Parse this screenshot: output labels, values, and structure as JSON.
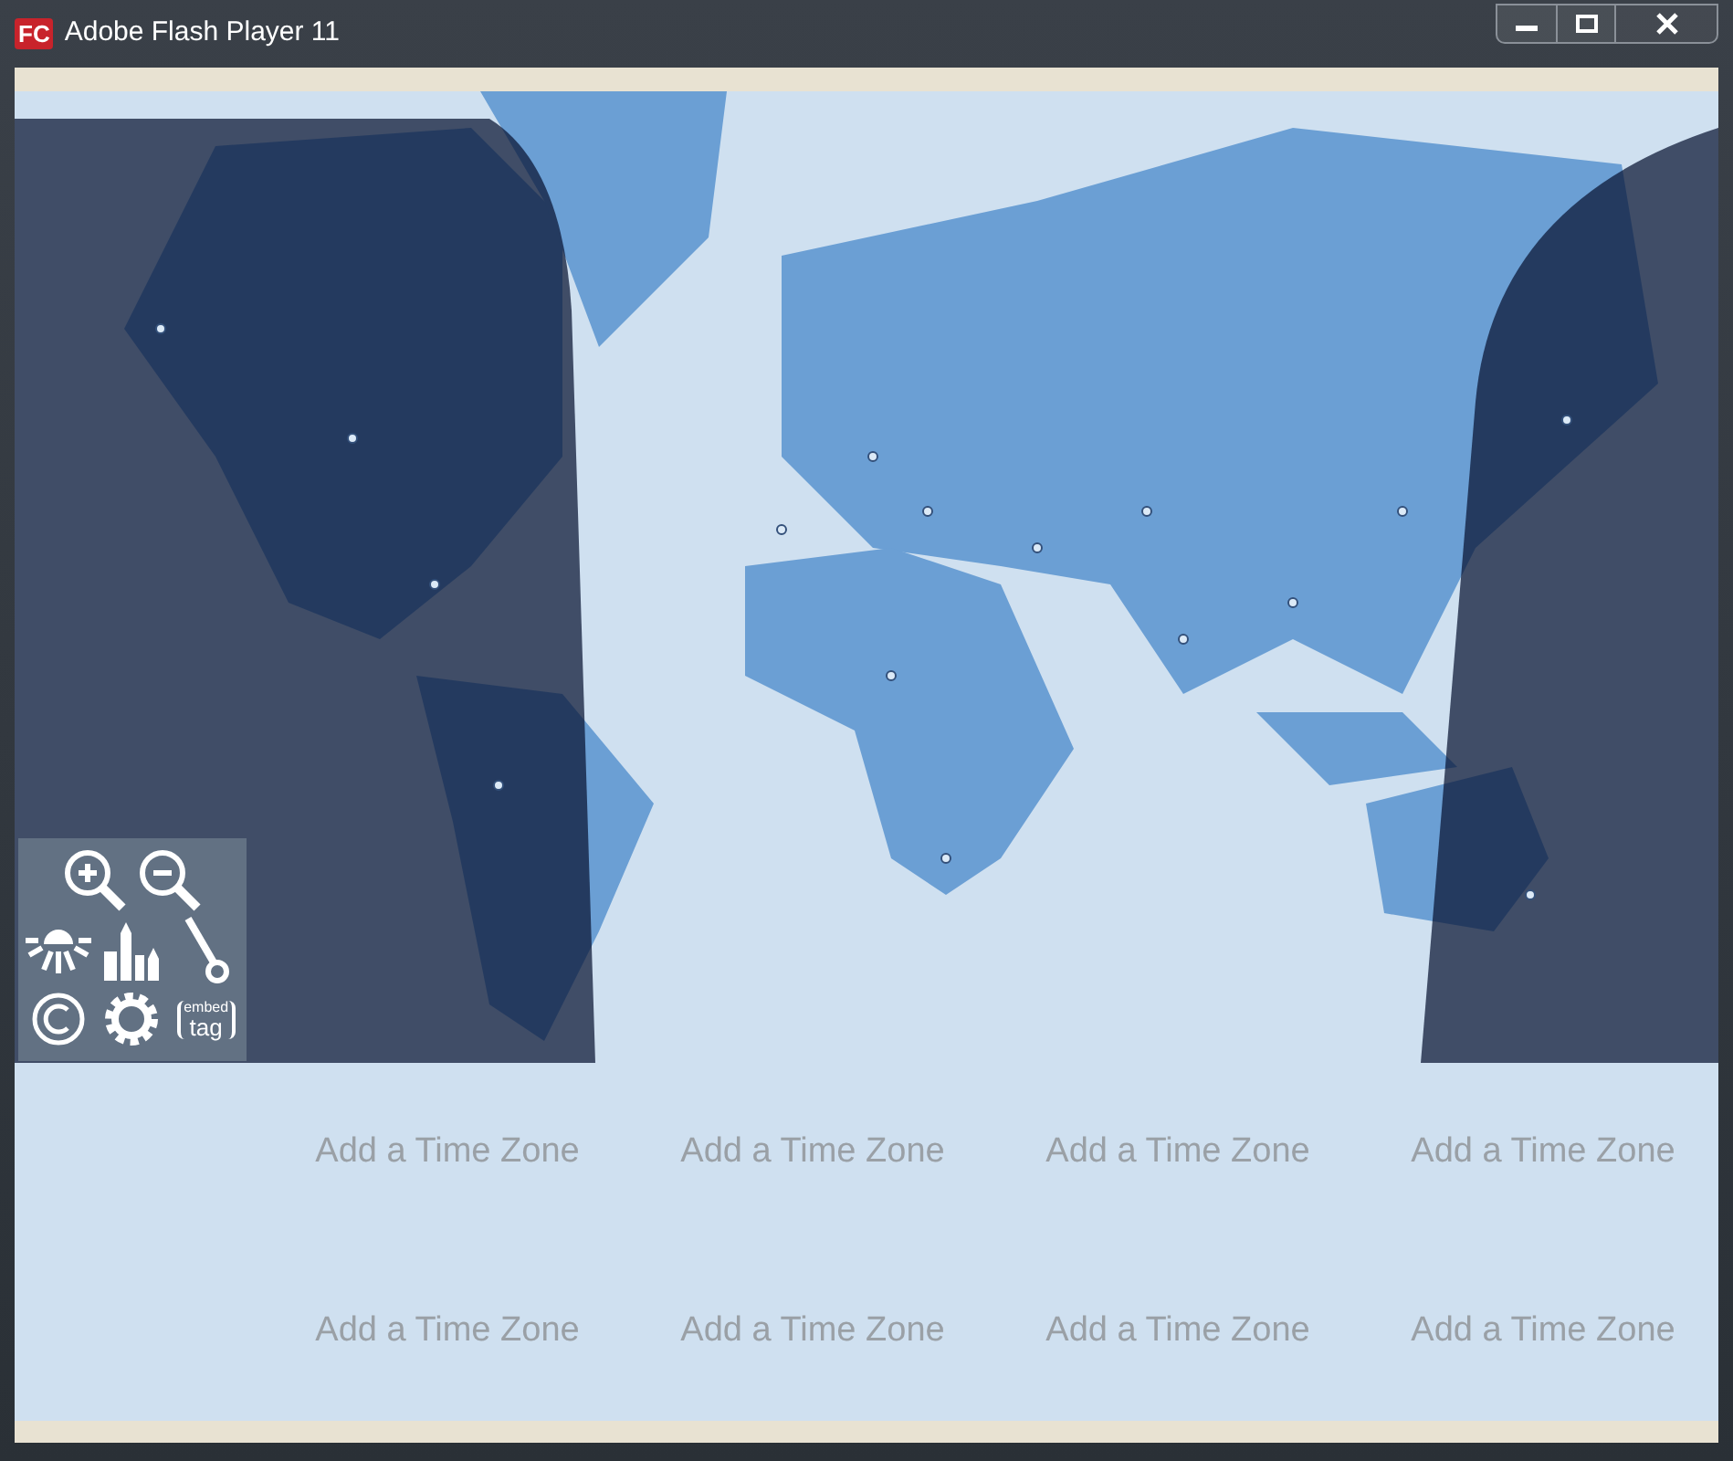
{
  "window": {
    "logo_text": "FC",
    "title": "Adobe Flash Player 11"
  },
  "toolbar": [
    {
      "kind": "zoom-in"
    },
    {
      "kind": "zoom-out"
    },
    {
      "kind": "sun"
    },
    {
      "kind": "city"
    },
    {
      "kind": "pin"
    },
    {
      "kind": "copyright"
    },
    {
      "kind": "settings"
    },
    {
      "kind": "embed",
      "top_text": "embed",
      "bottom_text": "tag"
    }
  ],
  "time_zones": [
    "Add a Time Zone",
    "Add a Time Zone",
    "Add a Time Zone",
    "Add a Time Zone",
    "Add a Time Zone",
    "Add a Time Zone",
    "Add a Time Zone",
    "Add a Time Zone"
  ]
}
